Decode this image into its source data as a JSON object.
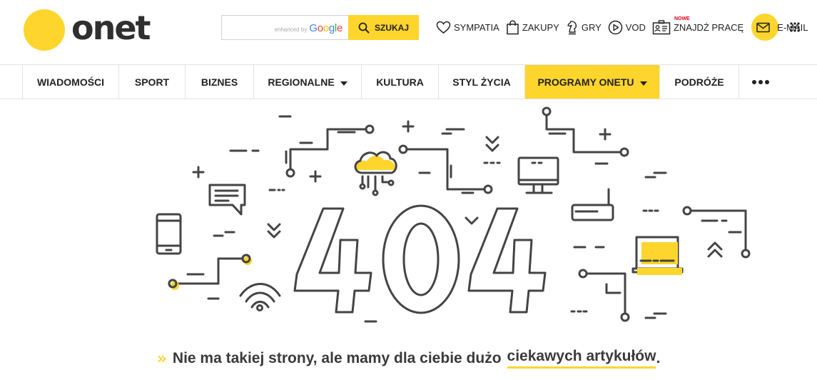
{
  "header": {
    "logo_text": "onet",
    "search": {
      "placeholder": "",
      "powered_prefix": "enhanced by",
      "powered_brand": [
        "G",
        "o",
        "o",
        "g",
        "l",
        "e"
      ],
      "button_label": "SZUKAJ"
    },
    "services": [
      {
        "label": "SYMPATIA",
        "icon": "heart-icon"
      },
      {
        "label": "ZAKUPY",
        "icon": "shopping-bag-icon"
      },
      {
        "label": "GRY",
        "icon": "chess-knight-icon"
      },
      {
        "label": "VOD",
        "icon": "play-icon"
      },
      {
        "label": "ZNAJDŹ PRACĘ",
        "icon": "id-card-icon",
        "badge": "NOWE"
      },
      {
        "label": "E-MAIL",
        "icon": "mail-icon"
      }
    ],
    "apps_icon": "apps-grid-icon"
  },
  "nav": {
    "items": [
      {
        "label": "WIADOMOŚCI"
      },
      {
        "label": "SPORT"
      },
      {
        "label": "BIZNES"
      },
      {
        "label": "REGIONALNE"
      },
      {
        "label": "KULTURA"
      },
      {
        "label": "STYL ŻYCIA"
      },
      {
        "label": "PROGRAMY ONETU"
      },
      {
        "label": "PODRÓŻE"
      }
    ],
    "more_icon": "more-dots-icon"
  },
  "error": {
    "code": "404"
  },
  "message": {
    "text": "Nie ma takiej strony, ale mamy dla ciebie dużo",
    "link": "ciekawych artykułów",
    "end": "."
  },
  "colors": {
    "brand_yellow": "#fdd52c",
    "text_dark": "#333333",
    "google_blue": "#4285f4",
    "google_red": "#ea4335",
    "google_yellow": "#fbbc05",
    "google_green": "#34a853"
  }
}
